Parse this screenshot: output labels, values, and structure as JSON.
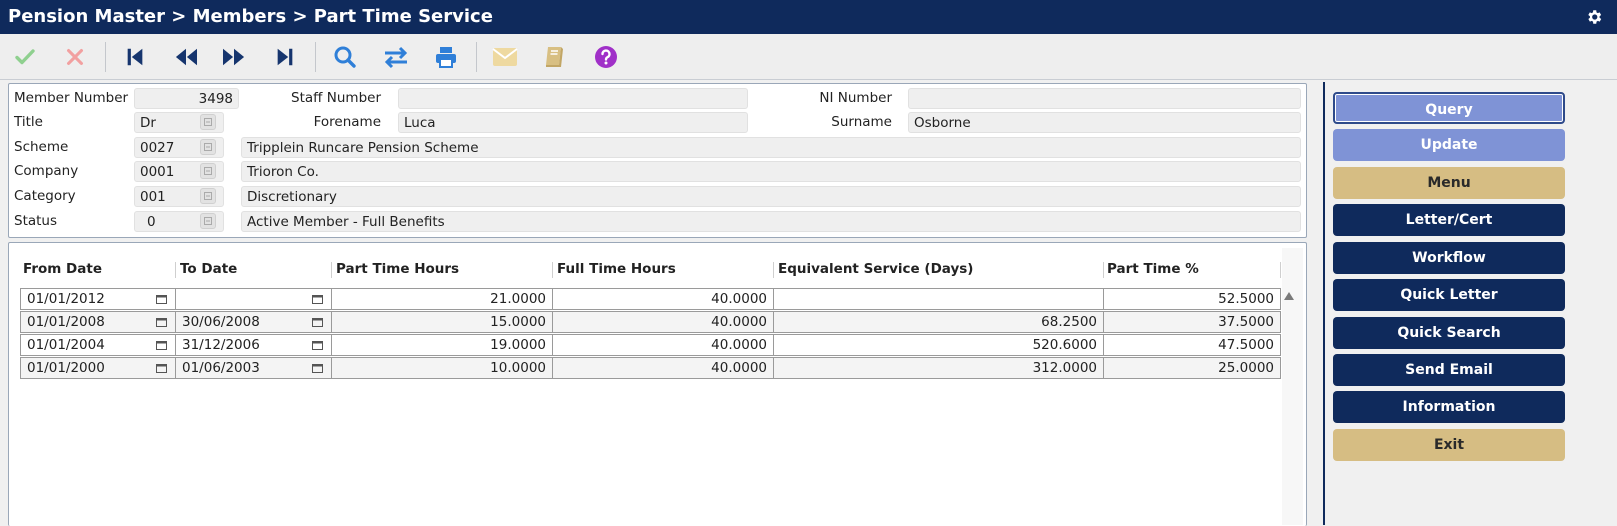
{
  "titlebar": {
    "title": "Pension Master > Members > Part Time Service",
    "settings_icon": "gear-icon"
  },
  "toolbar": {
    "buttons": [
      {
        "name": "confirm-icon",
        "color": "#8fd08f"
      },
      {
        "name": "cancel-icon",
        "color": "#f2a0a0"
      },
      {
        "name": "first-record-icon",
        "color": "#16356e"
      },
      {
        "name": "previous-record-icon",
        "color": "#16356e"
      },
      {
        "name": "next-record-icon",
        "color": "#16356e"
      },
      {
        "name": "last-record-icon",
        "color": "#16356e"
      },
      {
        "name": "search-icon",
        "color": "#2f7fd8"
      },
      {
        "name": "swap-icon",
        "color": "#2f7fd8"
      },
      {
        "name": "print-icon",
        "color": "#2f7fd8"
      },
      {
        "name": "mail-icon",
        "color": "#eed9a0"
      },
      {
        "name": "book-icon",
        "color": "#d8bf82"
      },
      {
        "name": "help-icon",
        "color": "#a030c8"
      }
    ]
  },
  "member": {
    "member_number_label": "Member Number",
    "member_number": "3498",
    "staff_number_label": "Staff Number",
    "staff_number": "",
    "ni_number_label": "NI Number",
    "ni_number": "",
    "title_label": "Title",
    "title": "Dr",
    "forename_label": "Forename",
    "forename": "Luca",
    "surname_label": "Surname",
    "surname": "Osborne",
    "scheme_label": "Scheme",
    "scheme_code": "0027",
    "scheme_name": "Tripplein Runcare Pension Scheme",
    "company_label": "Company",
    "company_code": "0001",
    "company_name": "Trioron Co.",
    "category_label": "Category",
    "category_code": "001",
    "category_name": "Discretionary",
    "status_label": "Status",
    "status_code": "0",
    "status_name": "Active Member - Full Benefits"
  },
  "grid": {
    "columns": [
      "From Date",
      "To Date",
      "Part Time Hours",
      "Full Time Hours",
      "Equivalent Service (Days)",
      "Part Time %"
    ],
    "rows": [
      [
        "01/01/2012",
        "",
        "21.0000",
        "40.0000",
        "",
        "52.5000"
      ],
      [
        "01/01/2008",
        "30/06/2008",
        "15.0000",
        "40.0000",
        "68.2500",
        "37.5000"
      ],
      [
        "01/01/2004",
        "31/12/2006",
        "19.0000",
        "40.0000",
        "520.6000",
        "47.5000"
      ],
      [
        "01/01/2000",
        "01/06/2003",
        "10.0000",
        "40.0000",
        "312.0000",
        "25.0000"
      ]
    ]
  },
  "sidebar": {
    "query": "Query",
    "update": "Update",
    "menu": "Menu",
    "letter_cert": "Letter/Cert",
    "workflow": "Workflow",
    "quick_letter": "Quick Letter",
    "quick_search": "Quick Search",
    "send_email": "Send Email",
    "information": "Information",
    "exit": "Exit"
  },
  "colors": {
    "navy": "#0f2a5c",
    "light_blue": "#7f93d6",
    "gold": "#d6bd83"
  }
}
